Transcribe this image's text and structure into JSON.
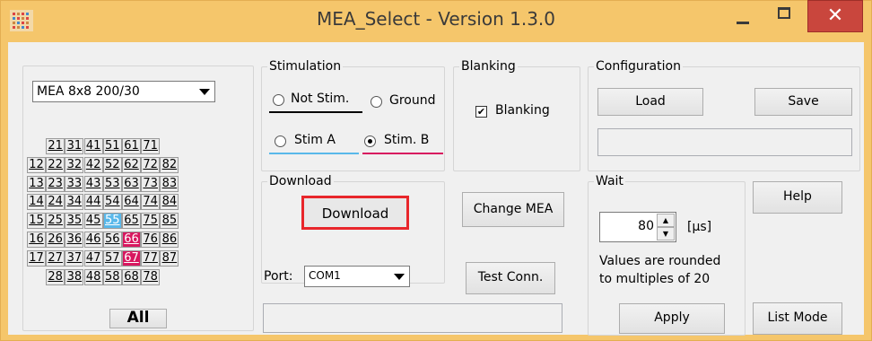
{
  "window": {
    "title": "MEA_Select  -  Version 1.3.0",
    "close_label": "✕"
  },
  "mea_panel": {
    "selected_layout": "MEA 8x8 200/30",
    "all_label": "All",
    "rows": [
      [
        "21",
        "31",
        "41",
        "51",
        "61",
        "71"
      ],
      [
        "12",
        "22",
        "32",
        "42",
        "52",
        "62",
        "72",
        "82"
      ],
      [
        "13",
        "23",
        "33",
        "43",
        "53",
        "63",
        "73",
        "83"
      ],
      [
        "14",
        "24",
        "34",
        "44",
        "54",
        "64",
        "74",
        "84"
      ],
      [
        "15",
        "25",
        "35",
        "45",
        "55",
        "65",
        "75",
        "85"
      ],
      [
        "16",
        "26",
        "36",
        "46",
        "56",
        "66",
        "76",
        "86"
      ],
      [
        "17",
        "27",
        "37",
        "47",
        "57",
        "67",
        "77",
        "87"
      ],
      [
        "28",
        "38",
        "48",
        "58",
        "68",
        "78"
      ]
    ],
    "highlights": {
      "55": "blue",
      "66": "red",
      "67": "red"
    },
    "colors": {
      "blue": "#59b8ea",
      "red": "#d8175f"
    }
  },
  "stimulation": {
    "legend": "Stimulation",
    "not_stim": "Not Stim.",
    "ground": "Ground",
    "stim_a": "Stim A",
    "stim_b": "Stim. B",
    "selected": "Stim. B",
    "colors": {
      "not_stim": "#000000",
      "stim_a": "#59b8ea",
      "stim_b": "#d8175f"
    }
  },
  "blanking": {
    "legend": "Blanking",
    "label": "Blanking",
    "checked": true,
    "check_mark": "✔"
  },
  "configuration": {
    "legend": "Configuration",
    "load_label": "Load",
    "save_label": "Save",
    "path_value": ""
  },
  "download": {
    "legend": "Download",
    "button_label": "Download",
    "highlight_color": "#e8262b"
  },
  "change_mea_label": "Change MEA",
  "port": {
    "label": "Port:",
    "value": "COM1",
    "test_label": "Test Conn."
  },
  "wait": {
    "legend": "Wait",
    "value": "80",
    "unit": "[µs]",
    "note_line1": "Values are rounded",
    "note_line2": "to multiples of 20",
    "apply_label": "Apply"
  },
  "help_label": "Help",
  "list_mode_label": "List Mode",
  "status_value": ""
}
